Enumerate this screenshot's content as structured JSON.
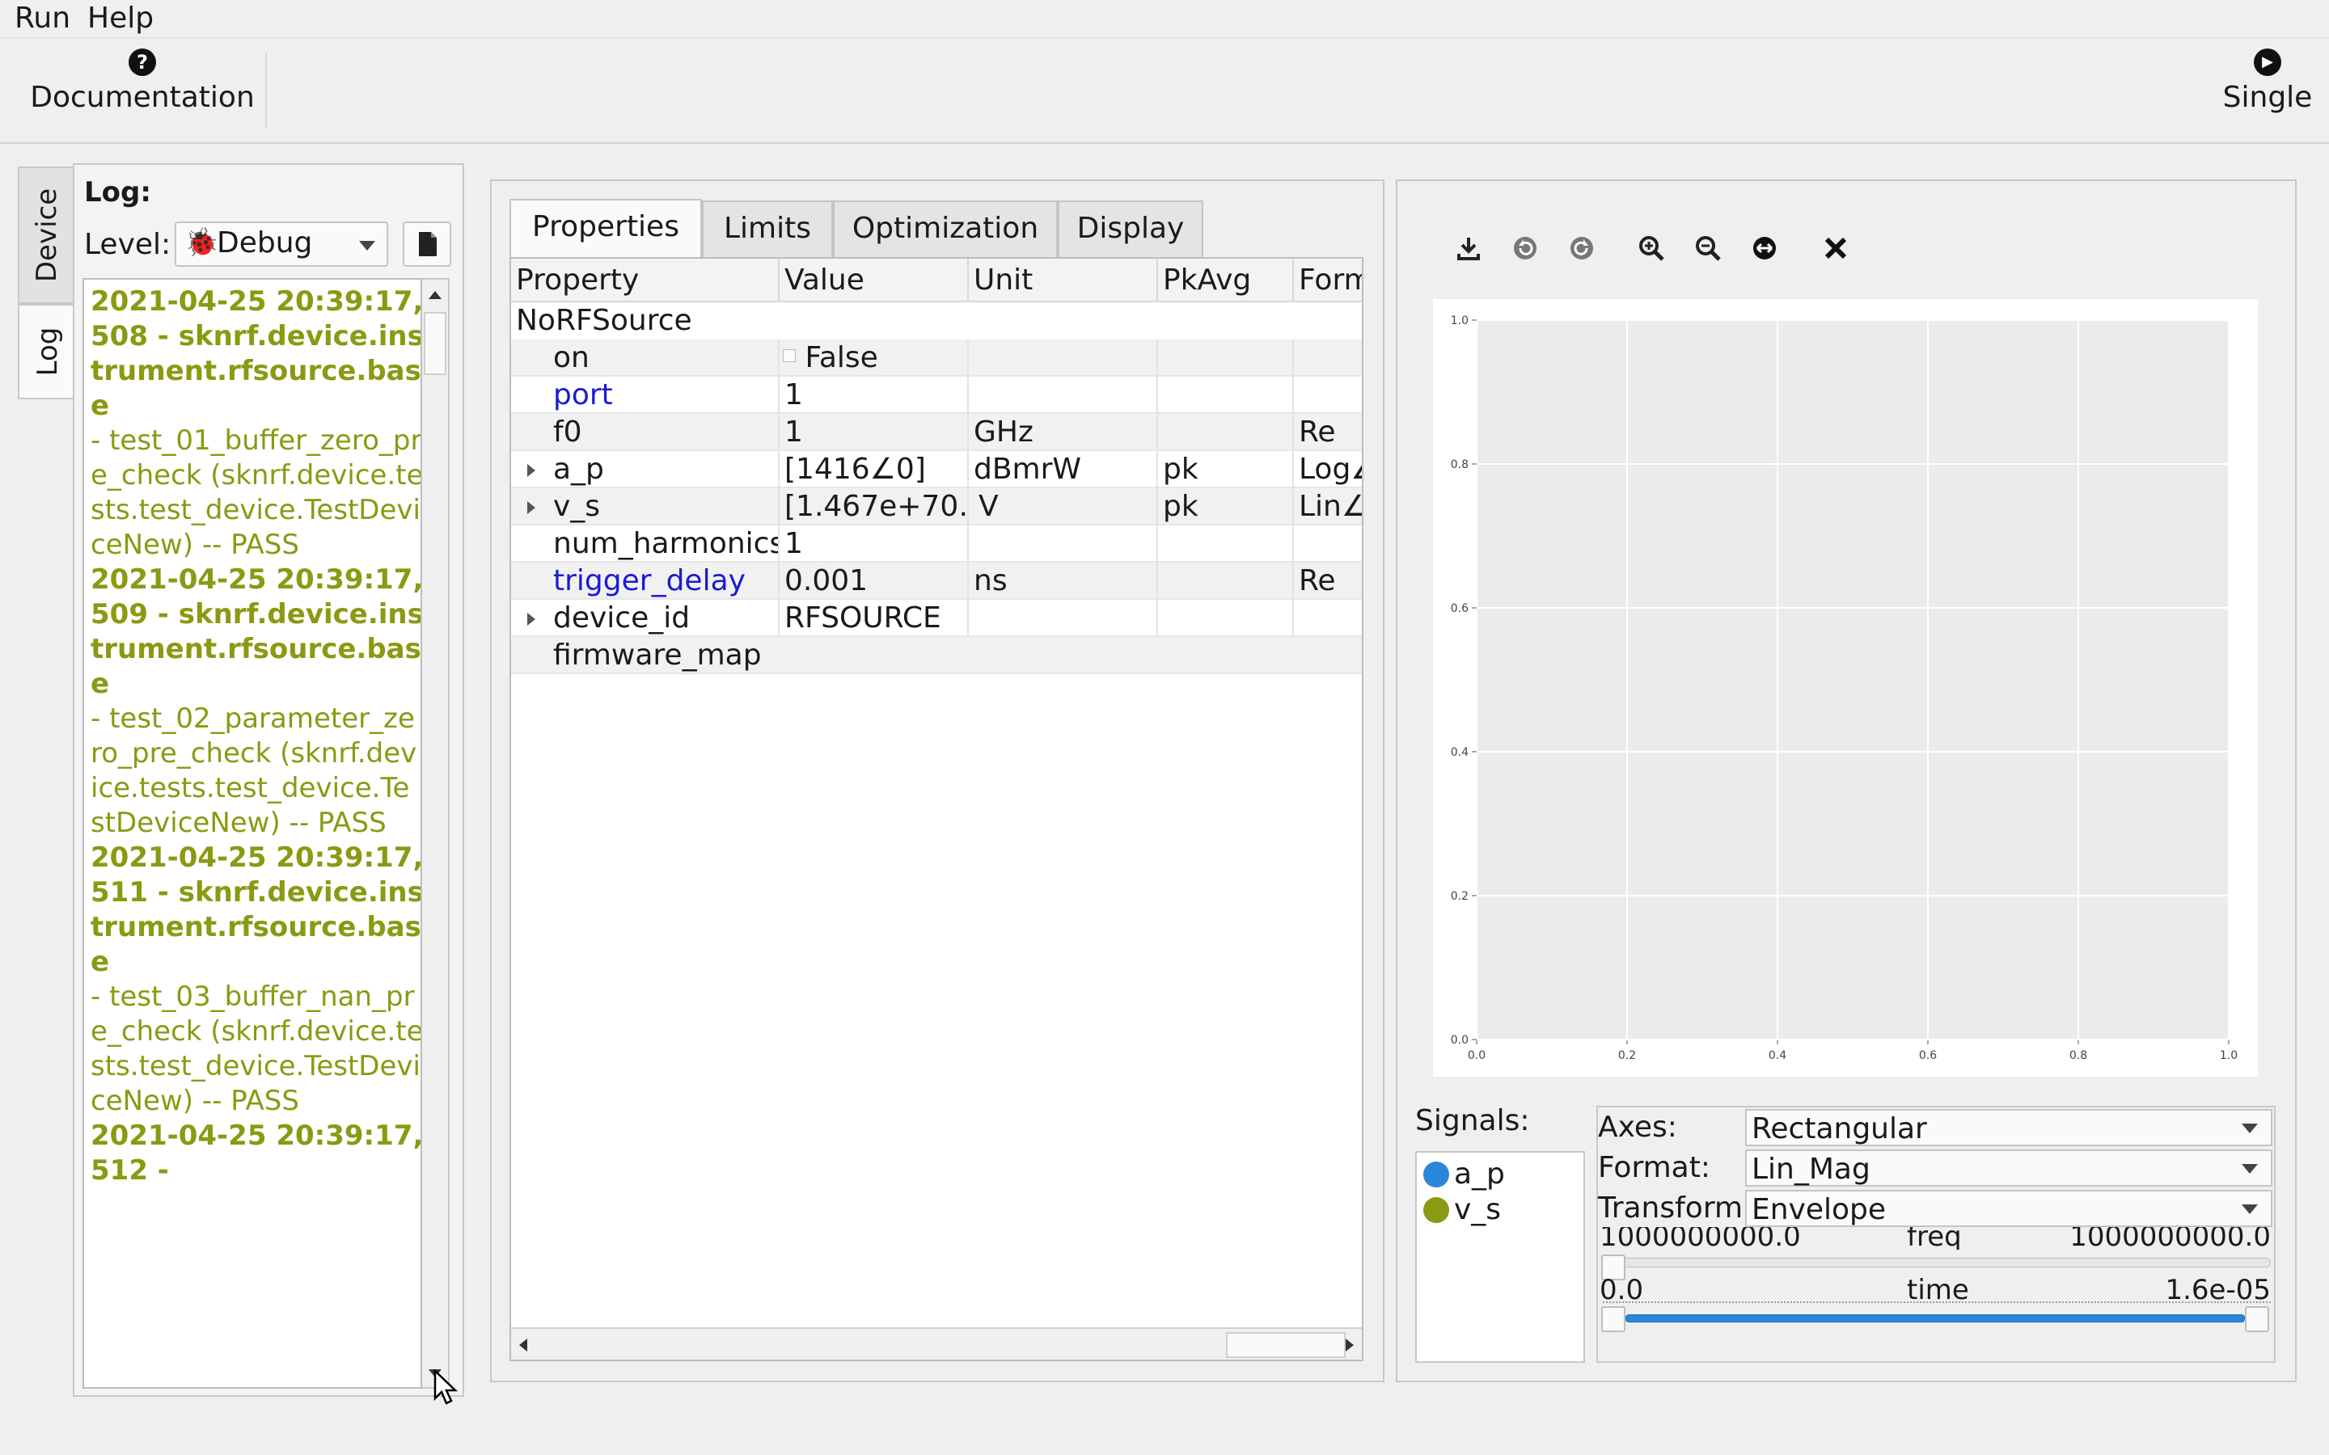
{
  "menu": [
    "Run",
    "Help"
  ],
  "toolbar": {
    "documentation": "Documentation",
    "single": "Single"
  },
  "side_tabs": {
    "device": "Device",
    "log": "Log"
  },
  "log": {
    "title": "Log:",
    "level_label": "Level:",
    "level_value": "Debug",
    "entries": [
      {
        "header": "2021-04-25 20:39:17,508 - sknrf.device.instrument.rfsource.base",
        "body": "- test_01_buffer_zero_pre_check (sknrf.device.tests.test_device.TestDeviceNew) -- PASS"
      },
      {
        "header": "2021-04-25 20:39:17,509 - sknrf.device.instrument.rfsource.base",
        "body": "- test_02_parameter_zero_pre_check (sknrf.device.tests.test_device.TestDeviceNew) -- PASS"
      },
      {
        "header": "2021-04-25 20:39:17,511 - sknrf.device.instrument.rfsource.base",
        "body": "- test_03_buffer_nan_pre_check (sknrf.device.tests.test_device.TestDeviceNew) -- PASS"
      },
      {
        "header": "2021-04-25 20:39:17,512 -",
        "body": ""
      }
    ]
  },
  "tabs": [
    "Properties",
    "Limits",
    "Optimization",
    "Display"
  ],
  "table": {
    "headers": [
      "Property",
      "Value",
      "Unit",
      "PkAvg",
      "Form"
    ],
    "group": "NoRFSource",
    "rows": [
      {
        "property": "on",
        "value": "False",
        "unit": "",
        "pkavg": "",
        "format": "",
        "checkbox": true
      },
      {
        "property": "port",
        "value": "1",
        "unit": "",
        "pkavg": "",
        "format": "",
        "blue": true
      },
      {
        "property": "f0",
        "value": "1",
        "unit": "GHz",
        "pkavg": "",
        "format": "Re"
      },
      {
        "property": "a_p",
        "value": "[1416∠0]",
        "unit": "dBmrW",
        "pkavg": "pk",
        "format": "Log∠",
        "expand": true
      },
      {
        "property": "v_s",
        "value": "[1.467e+70…",
        "unit": "V",
        "pkavg": "pk",
        "format": "Lin∠",
        "expand": true
      },
      {
        "property": "num_harmonics",
        "value": "1",
        "unit": "",
        "pkavg": "",
        "format": ""
      },
      {
        "property": "trigger_delay",
        "value": "0.001",
        "unit": "ns",
        "pkavg": "",
        "format": "Re",
        "blue": true
      },
      {
        "property": "device_id",
        "value": "RFSOURCE",
        "unit": "",
        "pkavg": "",
        "format": "",
        "expand": true
      },
      {
        "property": "firmware_map",
        "value": "",
        "unit": "",
        "pkavg": "",
        "format": ""
      }
    ]
  },
  "plot_tools": [
    "download-icon",
    "undo-icon",
    "redo-icon",
    "zoom-in-icon",
    "zoom-out-icon",
    "pan-icon",
    "clear-icon"
  ],
  "chart_data": {
    "type": "line",
    "series": [],
    "xlim": [
      0.0,
      1.0
    ],
    "ylim": [
      0.0,
      1.0
    ],
    "xticks": [
      "0.0",
      "0.2",
      "0.4",
      "0.6",
      "0.8",
      "1.0"
    ],
    "yticks": [
      "0.0",
      "0.2",
      "0.4",
      "0.6",
      "0.8",
      "1.0"
    ],
    "grid": true
  },
  "signals": {
    "label": "Signals:",
    "items": [
      {
        "name": "a_p",
        "color": "#2a86d8"
      },
      {
        "name": "v_s",
        "color": "#8a9a12"
      }
    ]
  },
  "controls": {
    "axes_label": "Axes:",
    "axes_value": "Rectangular",
    "format_label": "Format:",
    "format_value": "Lin_Mag",
    "transform_label": "Transform:",
    "transform_value": "Envelope",
    "freq_min": "1000000000.0",
    "freq_label": "freq",
    "freq_max": "1000000000.0",
    "time_min": "0.0",
    "time_label": "time",
    "time_max": "1.6e-05"
  },
  "colors": {
    "log_text": "#8a9a12",
    "link_blue": "#1a1ad6",
    "accent": "#2a86d8"
  }
}
